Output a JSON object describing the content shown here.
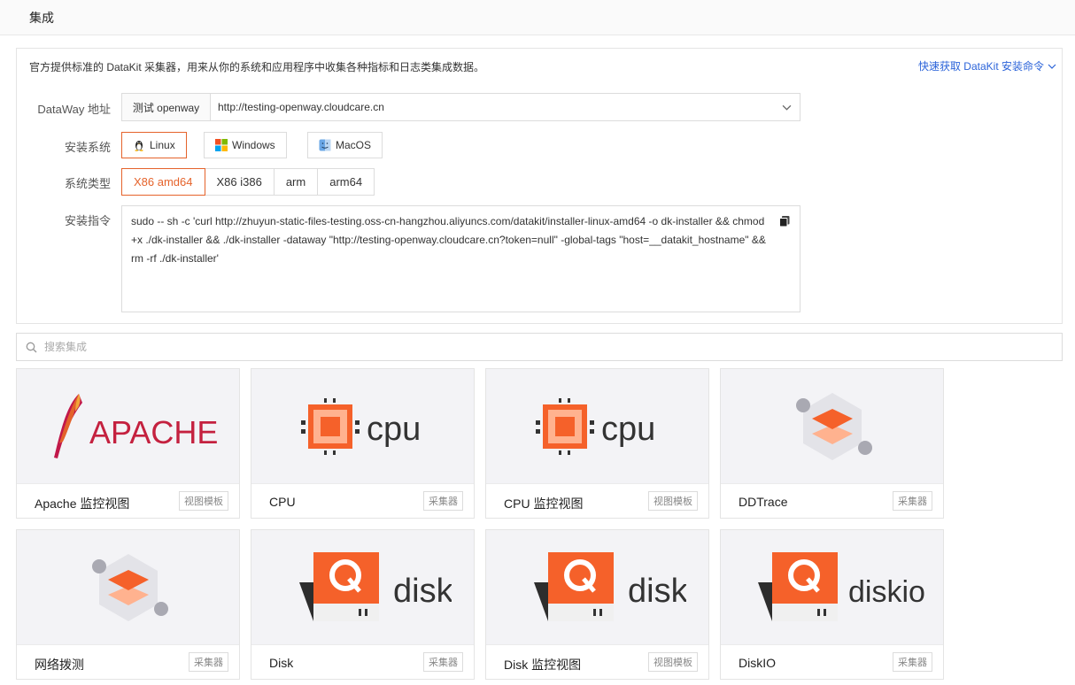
{
  "header": {
    "title": "集成"
  },
  "install": {
    "intro": "官方提供标准的 DataKit 采集器，用来从你的系统和应用程序中收集各种指标和日志类集成数据。",
    "quick_link": "快速获取 DataKit 安装命令",
    "labels": {
      "dataway": "DataWay 地址",
      "os": "安装系统",
      "arch": "系统类型",
      "command": "安装指令"
    },
    "dataway": {
      "name": "测试 openway",
      "url": "http://testing-openway.cloudcare.cn"
    },
    "os_options": [
      {
        "label": "Linux",
        "active": true
      },
      {
        "label": "Windows",
        "active": false
      },
      {
        "label": "MacOS",
        "active": false
      }
    ],
    "arch_options": [
      {
        "label": "X86 amd64",
        "active": true
      },
      {
        "label": "X86 i386",
        "active": false
      },
      {
        "label": "arm",
        "active": false
      },
      {
        "label": "arm64",
        "active": false
      }
    ],
    "command": "sudo -- sh -c 'curl http://zhuyun-static-files-testing.oss-cn-hangzhou.aliyuncs.com/datakit/installer-linux-amd64 -o dk-installer && chmod +x ./dk-installer && ./dk-installer -dataway \"http://testing-openway.cloudcare.cn?token=null\" -global-tags \"host=__datakit_hostname\" && rm -rf ./dk-installer'"
  },
  "search": {
    "placeholder": "搜索集成"
  },
  "cards": [
    {
      "name": "Apache 监控视图",
      "tag": "视图模板",
      "logo": "apache-logo",
      "logo_text": "APACHE"
    },
    {
      "name": "CPU",
      "tag": "采集器",
      "logo": "cpu-logo",
      "logo_text": "cpu"
    },
    {
      "name": "CPU 监控视图",
      "tag": "视图模板",
      "logo": "cpu-logo",
      "logo_text": "cpu"
    },
    {
      "name": "DDTrace",
      "tag": "采集器",
      "logo": "layers-hex-logo"
    },
    {
      "name": "网络拨测",
      "tag": "采集器",
      "logo": "layers-hex-logo"
    },
    {
      "name": "Disk",
      "tag": "采集器",
      "logo": "disk-logo",
      "logo_text": "disk"
    },
    {
      "name": "Disk 监控视图",
      "tag": "视图模板",
      "logo": "disk-logo",
      "logo_text": "disk"
    },
    {
      "name": "DiskIO",
      "tag": "采集器",
      "logo": "diskio-logo",
      "logo_text": "diskio"
    }
  ],
  "colors": {
    "accent": "#e5632b",
    "link": "#2b63d9",
    "logo_orange": "#f5612a"
  }
}
